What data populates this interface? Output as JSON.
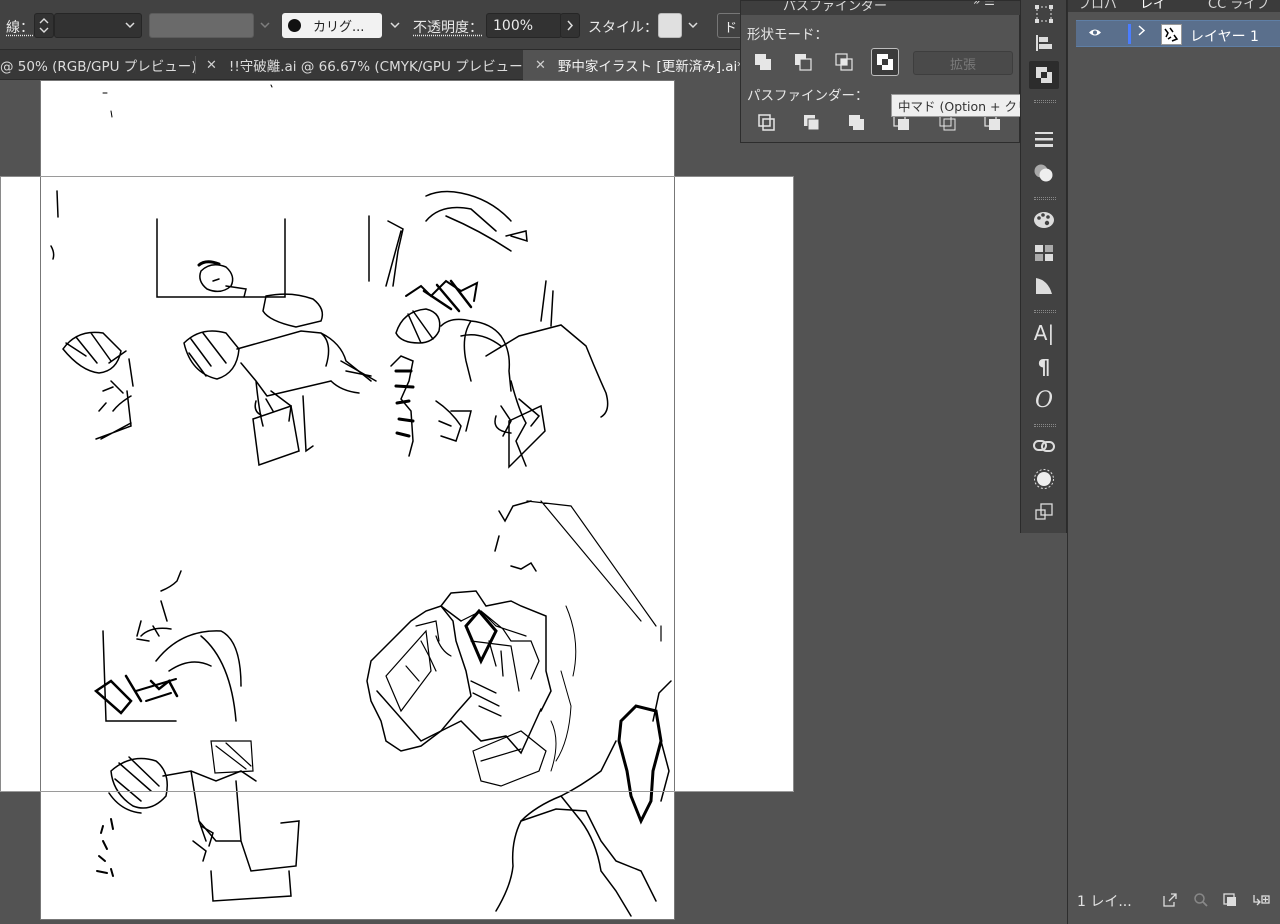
{
  "control_bar": {
    "stroke_label": "線：",
    "brush_name": "カリグ...",
    "opacity_label": "不透明度：",
    "opacity_value": "100%",
    "style_label": "スタイル：",
    "truncated_label": "ド"
  },
  "tabs": [
    {
      "label": "@ 50% (RGB/GPU プレビュー)",
      "active": false
    },
    {
      "label": "!!守破離.ai @ 66.67% (CMYK/GPU プレビュー)",
      "active": false
    },
    {
      "label": "野中家イラスト [更新済み].ai* @",
      "active": true
    }
  ],
  "pathfinder": {
    "tab_label": "パスファインダー",
    "shape_modes_label": "形状モード：",
    "pathfinders_label": "パスファインダー：",
    "expand_label": "拡張",
    "tooltip": "中マド (Option + クリックで複合シェイプを作成して重なりを除外)"
  },
  "dock_icons": [
    "transform-icon",
    "align-icon",
    "pathfinder-icon",
    "stroke-icon",
    "transparency-icon",
    "color-guide-icon",
    "swatches-icon",
    "gradient-icon",
    "character-icon",
    "paragraph-icon",
    "opentype-icon",
    "links-icon",
    "appearance-icon",
    "artboards-icon"
  ],
  "layers": {
    "tabs": [
      "プロパ",
      "レイ",
      "CC ライブ"
    ],
    "rows": [
      {
        "name": "レイヤー 1",
        "visible": true,
        "color": "#4a7dff"
      }
    ],
    "footer_count": "1 レイ..."
  },
  "colors": {
    "ui_dark": "#424242",
    "canvas_bg": "#535353",
    "layer_color": "#4a7dff"
  }
}
